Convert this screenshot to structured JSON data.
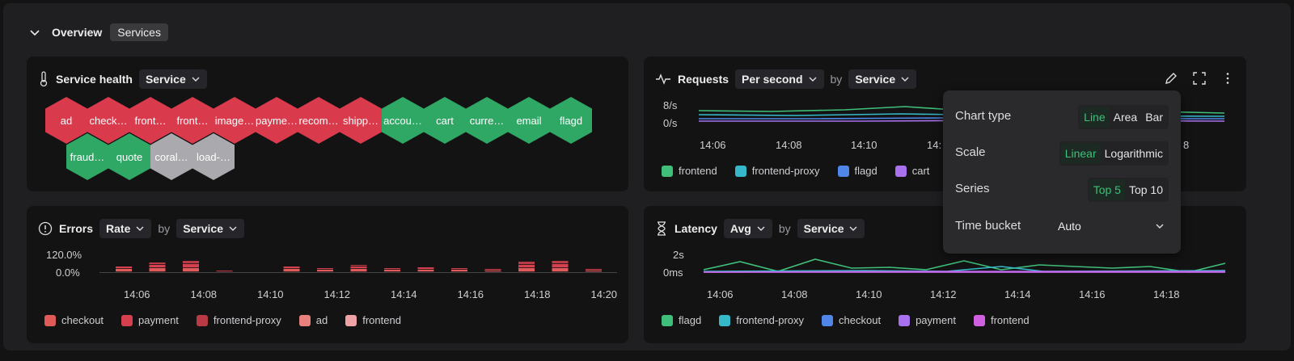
{
  "header": {
    "title": "Overview",
    "tag": "Services"
  },
  "health": {
    "title": "Service health",
    "group": "Service",
    "hexes": [
      {
        "label": "ad",
        "status": "error"
      },
      {
        "label": "check…",
        "status": "error"
      },
      {
        "label": "front…",
        "status": "error"
      },
      {
        "label": "front…",
        "status": "error"
      },
      {
        "label": "image…",
        "status": "error"
      },
      {
        "label": "payme…",
        "status": "error"
      },
      {
        "label": "recom…",
        "status": "error"
      },
      {
        "label": "shipp…",
        "status": "error"
      },
      {
        "label": "accou…",
        "status": "ok"
      },
      {
        "label": "cart",
        "status": "ok"
      },
      {
        "label": "curre…",
        "status": "ok"
      },
      {
        "label": "email",
        "status": "ok"
      },
      {
        "label": "flagd",
        "status": "ok"
      },
      {
        "label": "fraud…",
        "status": "ok"
      },
      {
        "label": "quote",
        "status": "ok"
      },
      {
        "label": "coral…",
        "status": "unknown"
      },
      {
        "label": "load-…",
        "status": "unknown"
      }
    ]
  },
  "requests": {
    "title": "Requests",
    "metric": "Per second",
    "by": "by",
    "group": "Service",
    "y_ticks": [
      "8/s",
      "0/s"
    ],
    "x_ticks": [
      "14:06",
      "14:08",
      "14:10",
      "14:"
    ],
    "x_tick_right": "8",
    "legend": [
      {
        "name": "frontend",
        "color": "#3fbf7a"
      },
      {
        "name": "frontend-proxy",
        "color": "#36b8c9"
      },
      {
        "name": "flagd",
        "color": "#4f86e8"
      },
      {
        "name": "cart",
        "color": "#a872ee"
      }
    ]
  },
  "errors": {
    "title": "Errors",
    "metric": "Rate",
    "by": "by",
    "group": "Service",
    "y_ticks": [
      "120.0%",
      "0.0%"
    ],
    "x_ticks": [
      "14:06",
      "14:08",
      "14:10",
      "14:12",
      "14:14",
      "14:16",
      "14:18",
      "14:20"
    ],
    "legend": [
      {
        "name": "checkout",
        "color": "#e05a5a"
      },
      {
        "name": "payment",
        "color": "#d6404e"
      },
      {
        "name": "frontend-proxy",
        "color": "#b83a44"
      },
      {
        "name": "ad",
        "color": "#e8807c"
      },
      {
        "name": "frontend",
        "color": "#eda3a3"
      }
    ]
  },
  "latency": {
    "title": "Latency",
    "metric": "Avg",
    "by": "by",
    "group": "Service",
    "y_ticks": [
      "2s",
      "0ms"
    ],
    "x_ticks": [
      "14:06",
      "14:08",
      "14:10",
      "14:12",
      "14:14",
      "14:16",
      "14:18"
    ],
    "legend": [
      {
        "name": "flagd",
        "color": "#3fbf7a"
      },
      {
        "name": "frontend-proxy",
        "color": "#36b8c9"
      },
      {
        "name": "checkout",
        "color": "#4f86e8"
      },
      {
        "name": "payment",
        "color": "#a872ee"
      },
      {
        "name": "frontend",
        "color": "#d060e0"
      }
    ]
  },
  "menu": {
    "chart_type": {
      "label": "Chart type",
      "options": [
        "Line",
        "Area",
        "Bar"
      ],
      "selected": "Line"
    },
    "scale": {
      "label": "Scale",
      "options": [
        "Linear",
        "Logarithmic"
      ],
      "selected": "Linear"
    },
    "series": {
      "label": "Series",
      "options": [
        "Top 5",
        "Top 10"
      ],
      "selected": "Top 5"
    },
    "time_bucket": {
      "label": "Time bucket",
      "value": "Auto"
    }
  },
  "colors": {
    "error": "#d93a4c",
    "ok": "#2fa866",
    "unknown": "#a9a9ae",
    "accent": "#3fbf7a"
  }
}
